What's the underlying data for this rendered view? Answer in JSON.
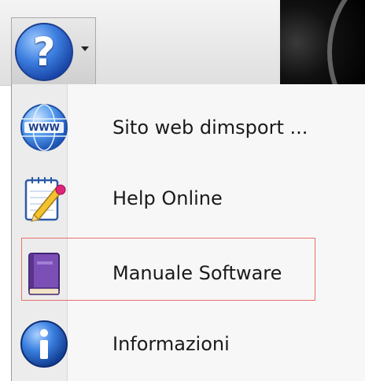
{
  "toolbar": {
    "help_button": {
      "icon": "help-question-icon",
      "glyph": "?",
      "dropdown_icon": "chevron-down-icon"
    }
  },
  "menu": {
    "items": [
      {
        "label": "Sito web dimsport ...",
        "icon": "www-globe-icon"
      },
      {
        "label": "Help Online",
        "icon": "notepad-pencil-icon"
      },
      {
        "label": "Manuale Software",
        "icon": "book-icon",
        "highlighted": true
      },
      {
        "label": "Informazioni",
        "icon": "info-icon"
      }
    ]
  },
  "colors": {
    "highlight_border": "#e8706a",
    "orb_blue": "#3d7fe0",
    "book_purple": "#7b4fb6"
  }
}
